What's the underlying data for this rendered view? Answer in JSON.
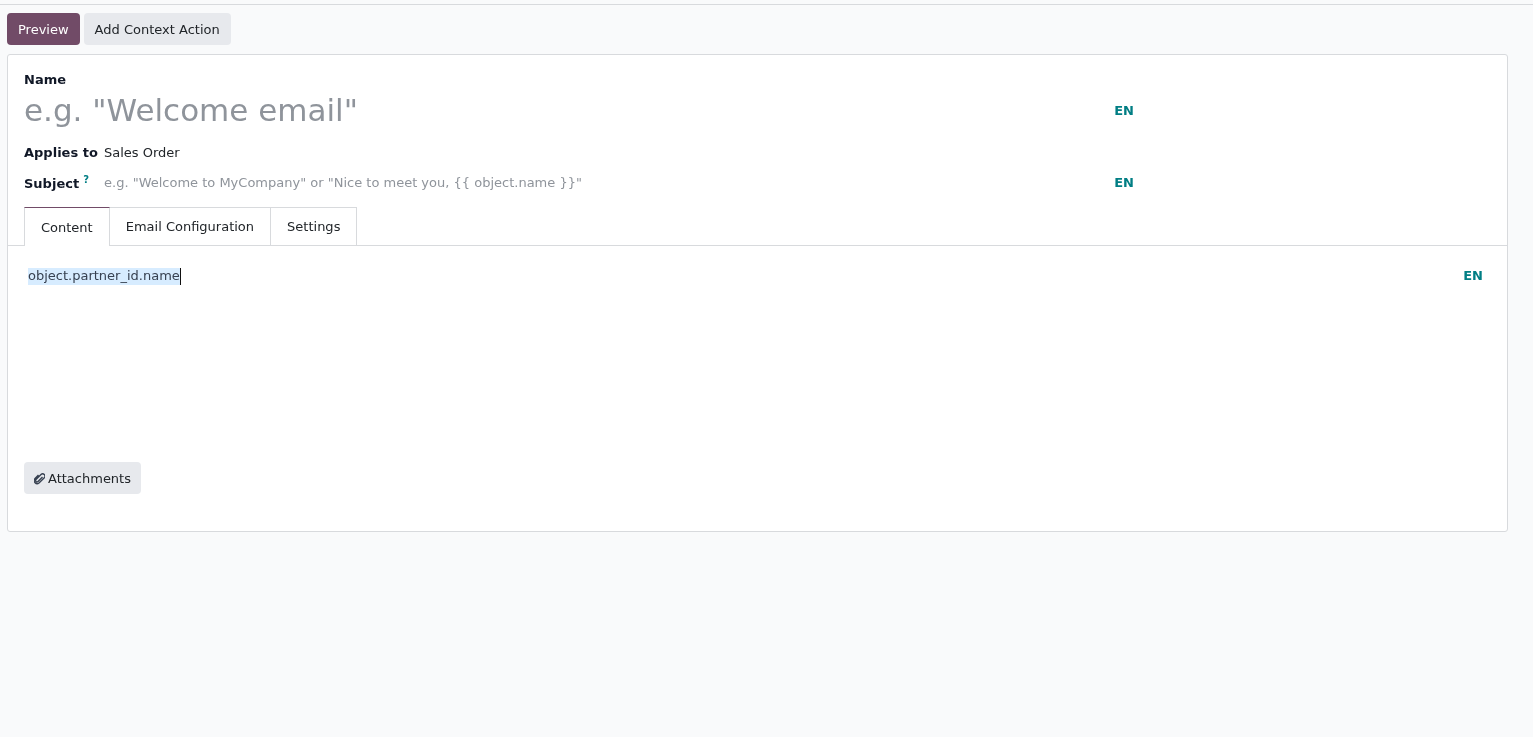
{
  "buttons": [
    {
      "label": "Preview",
      "kind": "primary"
    },
    {
      "label": "Add Context Action",
      "kind": "secondary"
    }
  ],
  "form": {
    "name_label": "Name",
    "name_placeholder": "e.g. \"Welcome email\"",
    "name_lang": "EN",
    "applies_label": "Applies to",
    "applies_value": "Sales Order",
    "subject_label": "Subject",
    "subject_help": "?",
    "subject_placeholder": "e.g. \"Welcome to MyCompany\" or \"Nice to meet you, {{ object.name }}\"",
    "subject_lang": "EN"
  },
  "tabs": [
    {
      "label": "Content",
      "selected": true
    },
    {
      "label": "Email Configuration",
      "selected": false
    },
    {
      "label": "Settings",
      "selected": false
    }
  ],
  "editor": {
    "text": "object.partner_id.name",
    "selected": true,
    "lang": "EN"
  },
  "attachments_button": {
    "label": "Attachments"
  }
}
